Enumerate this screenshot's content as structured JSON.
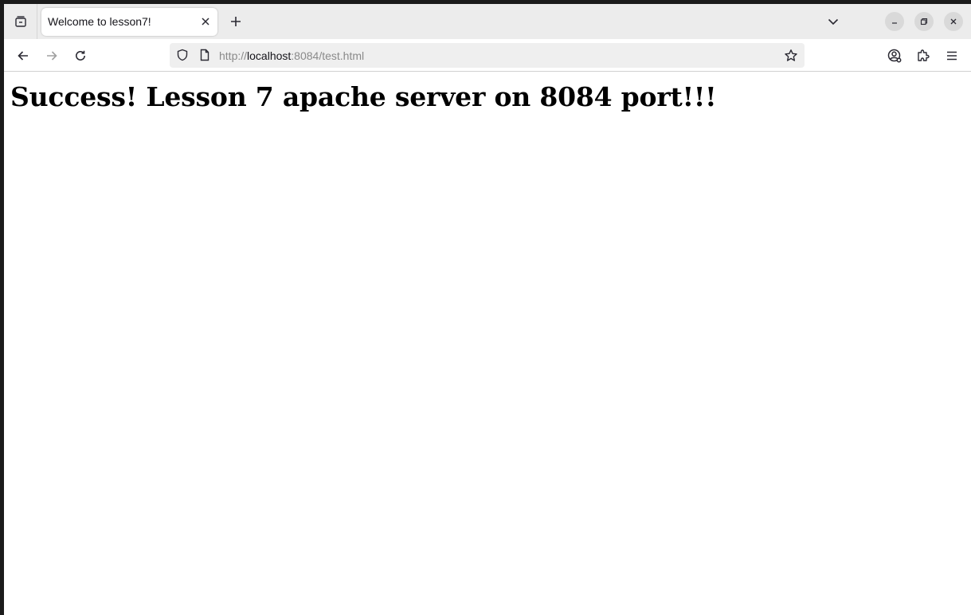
{
  "tab": {
    "title": "Welcome to lesson7!"
  },
  "urlbar": {
    "scheme": "http://",
    "host": "localhost",
    "rest": ":8084/test.html"
  },
  "page": {
    "heading": "Success! Lesson 7 apache server on 8084 port!!!"
  },
  "icons": {
    "tab_list": "tab-list-icon",
    "close_tab": "close-icon",
    "new_tab": "plus-icon",
    "all_tabs": "chevron-down-icon",
    "minimize": "minimize-icon",
    "restore": "restore-icon",
    "close_window": "close-icon",
    "back": "back-arrow-icon",
    "forward": "forward-arrow-icon",
    "reload": "reload-icon",
    "tracking_protection": "shield-icon",
    "page_info": "page-icon",
    "bookmark": "star-icon",
    "account": "account-icon",
    "extensions": "puzzle-icon",
    "menu": "hamburger-menu-icon"
  },
  "colors": {
    "chrome_bg": "#ececec",
    "urlbar_bg": "#efefef",
    "text_primary": "#15141a",
    "text_muted": "#8a8a8a",
    "disabled_icon": "#a0a0a0"
  }
}
